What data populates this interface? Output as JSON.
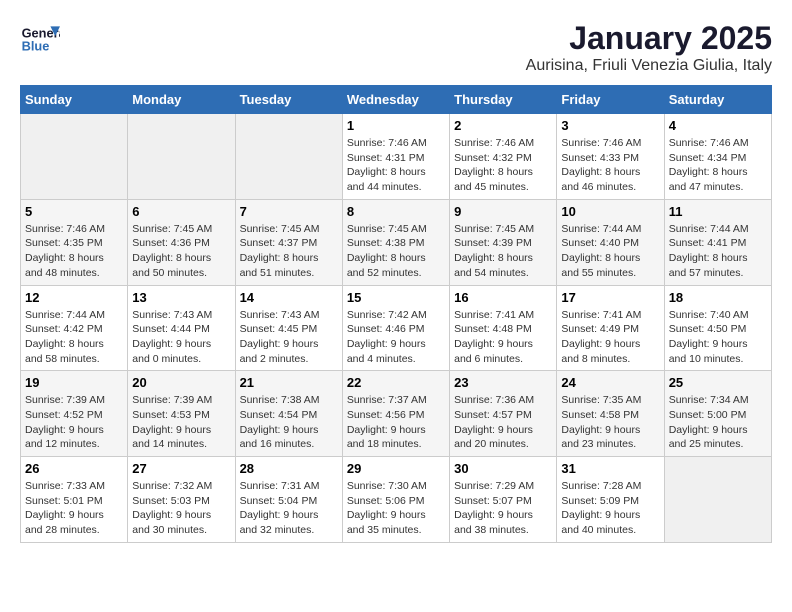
{
  "logo": {
    "line1": "General",
    "line2": "Blue"
  },
  "calendar": {
    "title": "January 2025",
    "subtitle": "Aurisina, Friuli Venezia Giulia, Italy"
  },
  "weekdays": [
    "Sunday",
    "Monday",
    "Tuesday",
    "Wednesday",
    "Thursday",
    "Friday",
    "Saturday"
  ],
  "weeks": [
    [
      {
        "day": "",
        "info": ""
      },
      {
        "day": "",
        "info": ""
      },
      {
        "day": "",
        "info": ""
      },
      {
        "day": "1",
        "info": "Sunrise: 7:46 AM\nSunset: 4:31 PM\nDaylight: 8 hours\nand 44 minutes."
      },
      {
        "day": "2",
        "info": "Sunrise: 7:46 AM\nSunset: 4:32 PM\nDaylight: 8 hours\nand 45 minutes."
      },
      {
        "day": "3",
        "info": "Sunrise: 7:46 AM\nSunset: 4:33 PM\nDaylight: 8 hours\nand 46 minutes."
      },
      {
        "day": "4",
        "info": "Sunrise: 7:46 AM\nSunset: 4:34 PM\nDaylight: 8 hours\nand 47 minutes."
      }
    ],
    [
      {
        "day": "5",
        "info": "Sunrise: 7:46 AM\nSunset: 4:35 PM\nDaylight: 8 hours\nand 48 minutes."
      },
      {
        "day": "6",
        "info": "Sunrise: 7:45 AM\nSunset: 4:36 PM\nDaylight: 8 hours\nand 50 minutes."
      },
      {
        "day": "7",
        "info": "Sunrise: 7:45 AM\nSunset: 4:37 PM\nDaylight: 8 hours\nand 51 minutes."
      },
      {
        "day": "8",
        "info": "Sunrise: 7:45 AM\nSunset: 4:38 PM\nDaylight: 8 hours\nand 52 minutes."
      },
      {
        "day": "9",
        "info": "Sunrise: 7:45 AM\nSunset: 4:39 PM\nDaylight: 8 hours\nand 54 minutes."
      },
      {
        "day": "10",
        "info": "Sunrise: 7:44 AM\nSunset: 4:40 PM\nDaylight: 8 hours\nand 55 minutes."
      },
      {
        "day": "11",
        "info": "Sunrise: 7:44 AM\nSunset: 4:41 PM\nDaylight: 8 hours\nand 57 minutes."
      }
    ],
    [
      {
        "day": "12",
        "info": "Sunrise: 7:44 AM\nSunset: 4:42 PM\nDaylight: 8 hours\nand 58 minutes."
      },
      {
        "day": "13",
        "info": "Sunrise: 7:43 AM\nSunset: 4:44 PM\nDaylight: 9 hours\nand 0 minutes."
      },
      {
        "day": "14",
        "info": "Sunrise: 7:43 AM\nSunset: 4:45 PM\nDaylight: 9 hours\nand 2 minutes."
      },
      {
        "day": "15",
        "info": "Sunrise: 7:42 AM\nSunset: 4:46 PM\nDaylight: 9 hours\nand 4 minutes."
      },
      {
        "day": "16",
        "info": "Sunrise: 7:41 AM\nSunset: 4:48 PM\nDaylight: 9 hours\nand 6 minutes."
      },
      {
        "day": "17",
        "info": "Sunrise: 7:41 AM\nSunset: 4:49 PM\nDaylight: 9 hours\nand 8 minutes."
      },
      {
        "day": "18",
        "info": "Sunrise: 7:40 AM\nSunset: 4:50 PM\nDaylight: 9 hours\nand 10 minutes."
      }
    ],
    [
      {
        "day": "19",
        "info": "Sunrise: 7:39 AM\nSunset: 4:52 PM\nDaylight: 9 hours\nand 12 minutes."
      },
      {
        "day": "20",
        "info": "Sunrise: 7:39 AM\nSunset: 4:53 PM\nDaylight: 9 hours\nand 14 minutes."
      },
      {
        "day": "21",
        "info": "Sunrise: 7:38 AM\nSunset: 4:54 PM\nDaylight: 9 hours\nand 16 minutes."
      },
      {
        "day": "22",
        "info": "Sunrise: 7:37 AM\nSunset: 4:56 PM\nDaylight: 9 hours\nand 18 minutes."
      },
      {
        "day": "23",
        "info": "Sunrise: 7:36 AM\nSunset: 4:57 PM\nDaylight: 9 hours\nand 20 minutes."
      },
      {
        "day": "24",
        "info": "Sunrise: 7:35 AM\nSunset: 4:58 PM\nDaylight: 9 hours\nand 23 minutes."
      },
      {
        "day": "25",
        "info": "Sunrise: 7:34 AM\nSunset: 5:00 PM\nDaylight: 9 hours\nand 25 minutes."
      }
    ],
    [
      {
        "day": "26",
        "info": "Sunrise: 7:33 AM\nSunset: 5:01 PM\nDaylight: 9 hours\nand 28 minutes."
      },
      {
        "day": "27",
        "info": "Sunrise: 7:32 AM\nSunset: 5:03 PM\nDaylight: 9 hours\nand 30 minutes."
      },
      {
        "day": "28",
        "info": "Sunrise: 7:31 AM\nSunset: 5:04 PM\nDaylight: 9 hours\nand 32 minutes."
      },
      {
        "day": "29",
        "info": "Sunrise: 7:30 AM\nSunset: 5:06 PM\nDaylight: 9 hours\nand 35 minutes."
      },
      {
        "day": "30",
        "info": "Sunrise: 7:29 AM\nSunset: 5:07 PM\nDaylight: 9 hours\nand 38 minutes."
      },
      {
        "day": "31",
        "info": "Sunrise: 7:28 AM\nSunset: 5:09 PM\nDaylight: 9 hours\nand 40 minutes."
      },
      {
        "day": "",
        "info": ""
      }
    ]
  ]
}
